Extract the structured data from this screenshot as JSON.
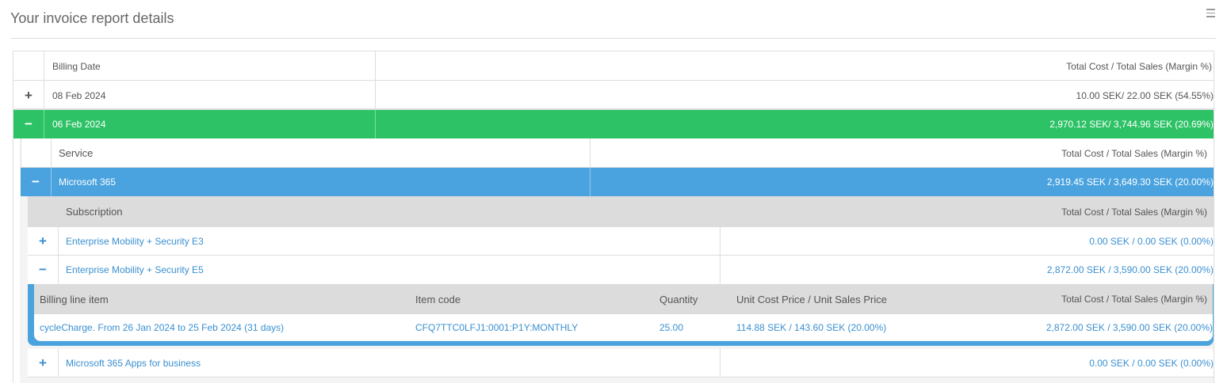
{
  "header": {
    "title": "Your invoice report details"
  },
  "icons": {
    "menu": "hamburger-menu-icon",
    "expand": "+",
    "collapse": "−"
  },
  "colors": {
    "active_date": "#2ec266",
    "active_service": "#4aa3df",
    "link": "#3a8fd0"
  },
  "dates_table": {
    "col_date": "Billing Date",
    "col_total": "Total Cost / Total Sales (Margin %)",
    "rows": [
      {
        "date": "08 Feb 2024",
        "total": "10.00 SEK/ 22.00 SEK (54.55%)",
        "expanded": false
      },
      {
        "date": "06 Feb 2024",
        "total": "2,970.12 SEK/ 3,744.96 SEK (20.69%)",
        "expanded": true
      }
    ]
  },
  "services_table": {
    "col_service": "Service",
    "col_total": "Total Cost / Total Sales (Margin %)",
    "rows": [
      {
        "service": "Microsoft 365",
        "total": "2,919.45 SEK / 3,649.30 SEK (20.00%)",
        "expanded": true
      }
    ]
  },
  "subscriptions_table": {
    "col_subscription": "Subscription",
    "col_total": "Total Cost / Total Sales (Margin %)",
    "rows": [
      {
        "name": "Enterprise Mobility + Security E3",
        "total": "0.00 SEK / 0.00 SEK (0.00%)",
        "expanded": false
      },
      {
        "name": "Enterprise Mobility + Security E5",
        "total": "2,872.00 SEK / 3,590.00 SEK (20.00%)",
        "expanded": true
      },
      {
        "name": "Microsoft 365 Apps for business",
        "total": "0.00 SEK / 0.00 SEK (0.00%)",
        "expanded": false
      }
    ]
  },
  "line_items_table": {
    "col_item": "Billing line item",
    "col_code": "Item code",
    "col_qty": "Quantity",
    "col_unit": "Unit Cost Price / Unit Sales Price",
    "col_total": "Total Cost / Total Sales (Margin %)",
    "rows": [
      {
        "item": "cycleCharge. From 26 Jan 2024 to 25 Feb 2024 (31 days)",
        "code": "CFQ7TTC0LFJ1:0001:P1Y:MONTHLY",
        "qty": "25.00",
        "unit": "114.88 SEK / 143.60 SEK (20.00%)",
        "total": "2,872.00 SEK / 3,590.00 SEK (20.00%)"
      }
    ]
  }
}
